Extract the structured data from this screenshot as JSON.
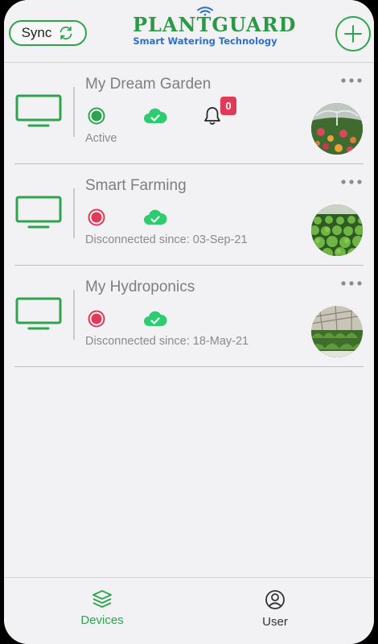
{
  "header": {
    "sync_label": "Sync",
    "logo_title": "PLANTGUARD",
    "logo_subtitle": "Smart Watering Technology"
  },
  "devices": [
    {
      "name": "My Dream Garden",
      "status": "Active",
      "status_color": "#2ea44f",
      "cloud_color": "#2ecc71",
      "notifications": "0",
      "thumb_icon": "sprinkler-garden-photo"
    },
    {
      "name": "Smart Farming",
      "status": "Disconnected since: 03-Sep-21",
      "status_color": "#e03a59",
      "cloud_color": "#2ecc71",
      "thumb_icon": "lettuce-farm-photo"
    },
    {
      "name": "My Hydroponics",
      "status": "Disconnected since: 18-May-21",
      "status_color": "#e03a59",
      "cloud_color": "#2ecc71",
      "thumb_icon": "greenhouse-photo"
    }
  ],
  "nav": {
    "devices_label": "Devices",
    "user_label": "User"
  },
  "colors": {
    "accent": "#2ea44f",
    "alert": "#e03a59",
    "logo_blue": "#2a6fc9"
  }
}
